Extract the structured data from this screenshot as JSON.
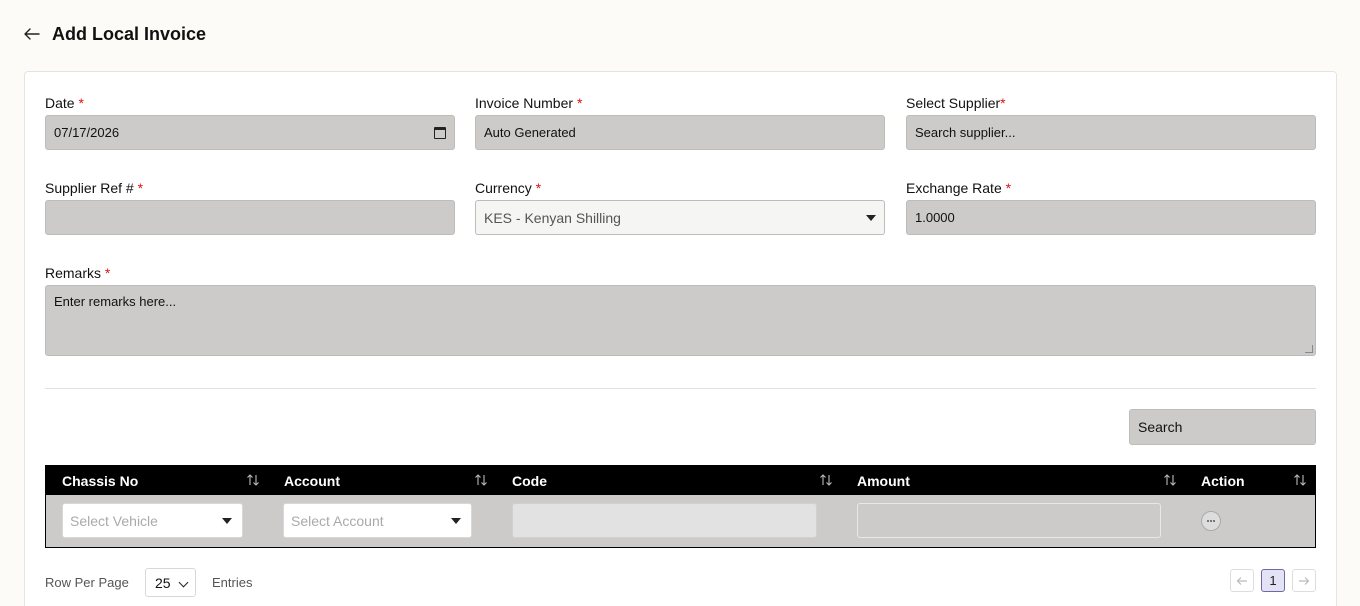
{
  "page": {
    "title": "Add Local Invoice",
    "back_icon": "arrow-left-icon"
  },
  "form": {
    "date": {
      "label": "Date",
      "required_mark": "*",
      "value": "07/17/2026"
    },
    "invoice_number": {
      "label": "Invoice Number",
      "required_mark": "*",
      "value": "Auto Generated"
    },
    "supplier": {
      "label": "Select Supplier",
      "required_mark": "*",
      "placeholder": "Search supplier..."
    },
    "supplier_ref": {
      "label": "Supplier Ref #",
      "required_mark": "*",
      "value": ""
    },
    "currency": {
      "label": "Currency",
      "required_mark": "*",
      "value": "KES - Kenyan Shilling"
    },
    "exchange_rate": {
      "label": "Exchange Rate",
      "required_mark": "*",
      "value": "1.0000"
    },
    "remarks": {
      "label": "Remarks",
      "required_mark": "*",
      "placeholder": "Enter remarks here..."
    }
  },
  "table": {
    "search_placeholder": "Search",
    "columns": [
      "Chassis No",
      "Account",
      "Code",
      "Amount",
      "Action"
    ],
    "row": {
      "vehicle_placeholder": "Select Vehicle",
      "account_placeholder": "Select Account",
      "code": "",
      "amount": ""
    }
  },
  "pagination": {
    "rows_per_page_label": "Row Per Page",
    "rows_per_page": "25",
    "entries_label": "Entries",
    "current_page": "1",
    "prev_icon": "arrow-left-icon",
    "next_icon": "arrow-right-icon"
  },
  "colors": {
    "header_bg": "#000000",
    "input_bg": "#cccbc9",
    "required": "#dd1111",
    "active_page": "#e4e2f5"
  }
}
